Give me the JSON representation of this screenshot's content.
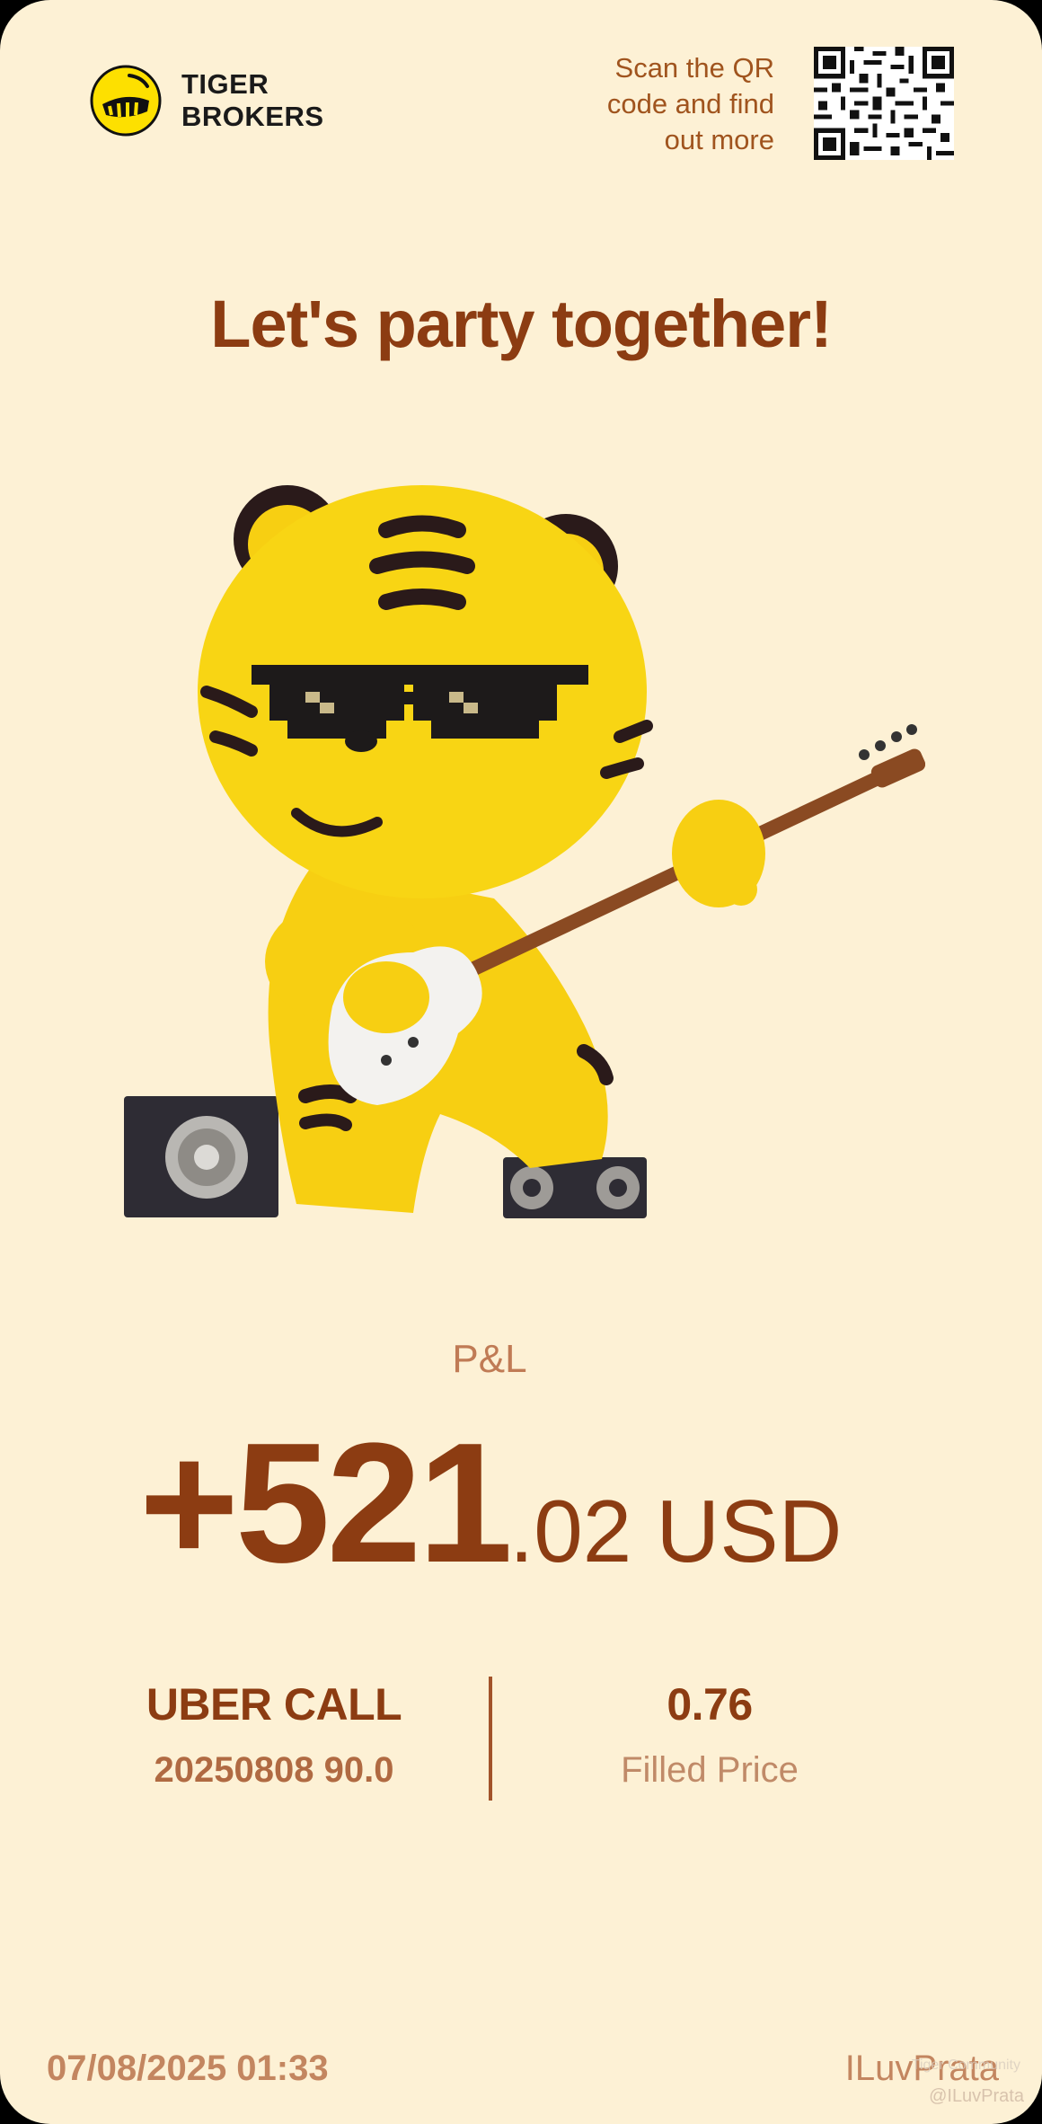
{
  "brand": {
    "name_line1": "TIGER",
    "name_line2": "BROKERS"
  },
  "promo": {
    "line1": "Scan the QR",
    "line2": "code and find",
    "line3": "out more"
  },
  "headline": "Let's party together!",
  "pnl": {
    "label": "P&L",
    "integer": "+521",
    "decimal": ".02 USD"
  },
  "trade": {
    "instrument": "UBER CALL",
    "contract": "20250808 90.0",
    "price_value": "0.76",
    "price_label": "Filled Price"
  },
  "footer": {
    "timestamp": "07/08/2025 01:33",
    "username": "ILuvPrata"
  },
  "watermark": {
    "community": "Tiger Community",
    "handle": "@ILuvPrata"
  },
  "colors": {
    "background": "#fdf1d5",
    "accent": "#8c3c12",
    "muted": "#c38660",
    "logo_yellow": "#fde000"
  },
  "icons": [
    "tiger-logo-icon",
    "qr-code-icon"
  ]
}
